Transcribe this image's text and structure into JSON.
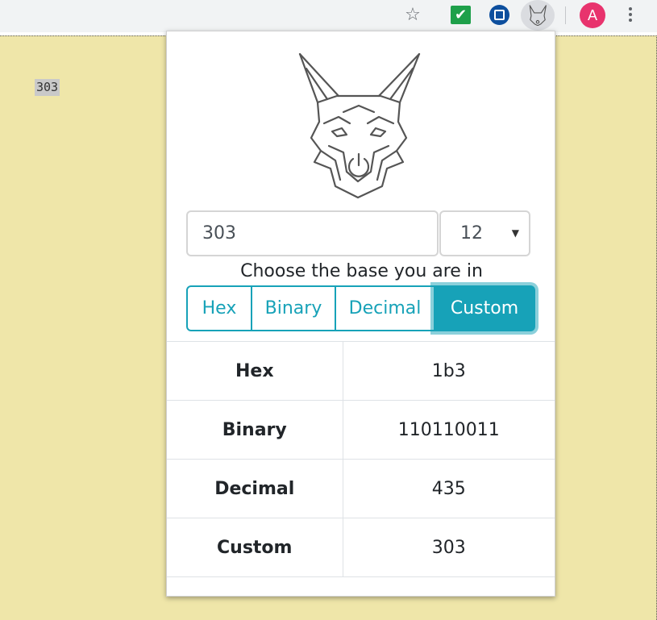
{
  "browser": {
    "bookmark_icon": "star-outline-icon",
    "extensions": [
      "green-check-extension-icon",
      "blue-square-extension-icon",
      "fox-extension-icon"
    ],
    "profile_initial": "A",
    "profile_color": "#e8336d",
    "menu_icon": "kebab-menu-icon"
  },
  "page": {
    "background": "#efe6a9",
    "selected_text": "303"
  },
  "popup": {
    "logo_icon": "fox-head-icon",
    "number_input": "303",
    "base_select": {
      "value": "12"
    },
    "prompt": "Choose the base you are in",
    "accent": "#17a2b8",
    "base_buttons": [
      {
        "label": "Hex",
        "active": false
      },
      {
        "label": "Binary",
        "active": false
      },
      {
        "label": "Decimal",
        "active": false
      },
      {
        "label": "Custom",
        "active": true
      }
    ],
    "results": [
      {
        "label": "Hex",
        "value": "1b3"
      },
      {
        "label": "Binary",
        "value": "110110011"
      },
      {
        "label": "Decimal",
        "value": "435"
      },
      {
        "label": "Custom",
        "value": "303"
      }
    ]
  }
}
